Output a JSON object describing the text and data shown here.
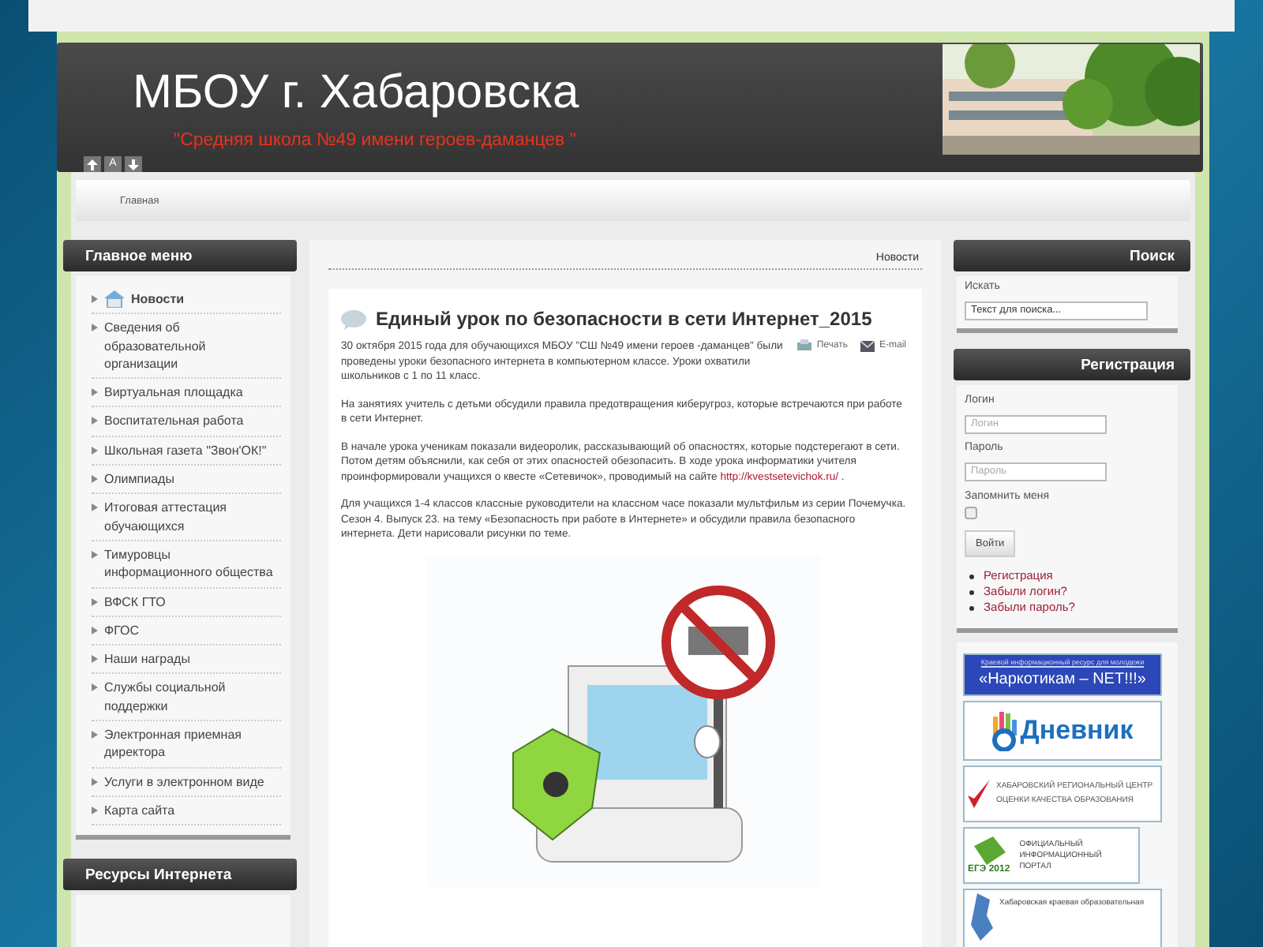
{
  "site": {
    "title": "МБОУ г. Хабаровска",
    "subtitle": "\"Средняя школа №49 имени героев-даманцев \""
  },
  "font_controls": [
    {
      "kind": "up"
    },
    {
      "kind": "text",
      "label": "A"
    },
    {
      "kind": "down"
    }
  ],
  "breadcrumb": [
    "Главная"
  ],
  "main_menu": {
    "title": "Главное меню",
    "items": [
      {
        "label": "Новости",
        "selected": true
      },
      {
        "label": "Сведения об образовательной организации",
        "selected": false
      },
      {
        "label": "Виртуальная площадка",
        "selected": false
      },
      {
        "label": "Воспитательная работа",
        "selected": false
      },
      {
        "label": "Школьная газета \"Звон'ОК!\"",
        "selected": false
      },
      {
        "label": "Олимпиады",
        "selected": false
      },
      {
        "label": "Итоговая аттестация обучающихся",
        "selected": false
      },
      {
        "label": "Тимуровцы информационного общества",
        "selected": false
      },
      {
        "label": "ВФСК ГТО",
        "selected": false
      },
      {
        "label": "ФГОС",
        "selected": false
      },
      {
        "label": "Наши награды",
        "selected": false
      },
      {
        "label": "Службы социальной поддержки",
        "selected": false
      },
      {
        "label": "Электронная приемная директора",
        "selected": false
      },
      {
        "label": "Услуги в электронном виде",
        "selected": false
      },
      {
        "label": "Карта сайта",
        "selected": false
      }
    ]
  },
  "resources": {
    "title": "Ресурсы Интернета"
  },
  "content": {
    "section": "Новости",
    "article": {
      "title": "Единый урок по безопасности в сети Интернет_2015",
      "actions": [
        {
          "kind": "print",
          "label": "Печать"
        },
        {
          "kind": "email",
          "label": "E-mail"
        }
      ],
      "intro": "30 октября 2015 года  для обучающихся МБОУ \"СШ №49 имени героев -даманцев\" были проведены уроки безопасного интернета в компьютерном классе. Уроки охватили школьников с 1 по 11 класс.",
      "paragraphs": [
        {
          "text": "На занятиях учитель с детьми обсудили правила предотвращения киберугроз, которые встречаются при работе в сети Интернет."
        },
        {
          "text": "В начале урока ученикам показали видеоролик, рассказывающий об опасностях, которые подстерегают в сети. Потом детям объяснили, как себя от этих опасностей обезопасить. В ходе урока информатики учителя проинформировали учащихся о квесте «Сетевичок», проводимый на сайте ",
          "link": "http://kvestsetevichok.ru/",
          "after": " ."
        },
        {
          "text": "Для учащихся 1-4 классов классные руководители на классном часе показали мультфильм из серии Почемучка. Сезон 4. Выпуск 23. на тему «Безопасность при работе в Интернете» и обсудили правила безопасного интернета. Дети нарисовали рисунки по теме."
        }
      ]
    }
  },
  "search": {
    "title": "Поиск",
    "label": "Искать",
    "value": "Текст для поиска..."
  },
  "login": {
    "title": "Регистрация",
    "fields": [
      {
        "label": "Логин",
        "placeholder": "Логин"
      },
      {
        "label": "Пароль",
        "placeholder": "Пароль"
      }
    ],
    "remember": {
      "label": "Запомнить меня",
      "checked": false
    },
    "button": "Войти",
    "links": [
      "Регистрация",
      "Забыли логин?",
      "Забыли пароль?"
    ]
  },
  "banners": [
    {
      "kind": "narkotikam",
      "caption": "Краевой информационный ресурс для молодежи",
      "text": "«Наркотикам – NET!!!»"
    },
    {
      "kind": "dnevnik",
      "text": "Дневник"
    },
    {
      "kind": "center",
      "lines": [
        "ХАБАРОВСКИЙ РЕГИОНАЛЬНЫЙ ЦЕНТР",
        "ОЦЕНКИ КАЧЕСТВА ОБРАЗОВАНИЯ"
      ]
    },
    {
      "kind": "ege",
      "badge": "ЕГЭ 2012",
      "lines": [
        "ОФИЦИАЛЬНЫЙ",
        "ИНФОРМАЦИОННЫЙ",
        "ПОРТАЛ"
      ]
    },
    {
      "kind": "network",
      "lines": [
        "Хабаровская краевая образовательная"
      ]
    }
  ]
}
